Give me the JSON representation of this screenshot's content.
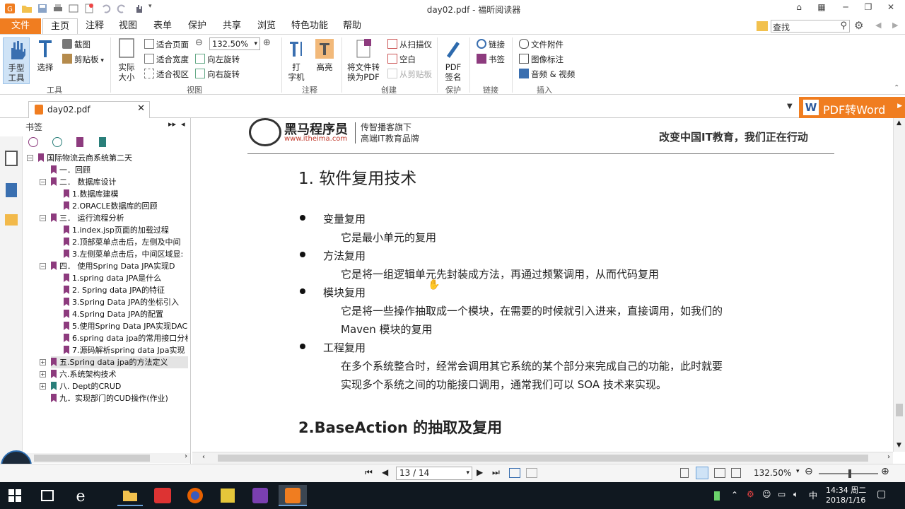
{
  "window": {
    "title": "day02.pdf - 福昕阅读器"
  },
  "menu": {
    "file": "文件",
    "tabs": [
      "主页",
      "注释",
      "视图",
      "表单",
      "保护",
      "共享",
      "浏览",
      "特色功能",
      "帮助"
    ],
    "search_placeholder": "查找"
  },
  "ribbon": {
    "tools": {
      "hand": "手型\n工具",
      "hand_l1": "手型",
      "hand_l2": "工具",
      "select": "选择",
      "screenshot": "截图",
      "clipboard": "剪贴板",
      "group": "工具"
    },
    "view": {
      "actual_l1": "实际",
      "actual_l2": "大小",
      "fit_page": "适合页面",
      "fit_width": "适合宽度",
      "fit_visible": "适合视区",
      "zoom_value": "132.50%",
      "rotate_left": "向左旋转",
      "rotate_right": "向右旋转",
      "group": "视图"
    },
    "comment": {
      "type_l1": "打",
      "type_l2": "字机",
      "highlight": "高亮",
      "group": "注释"
    },
    "create": {
      "convert_l1": "将文件转",
      "convert_l2": "换为PDF",
      "from_scanner": "从扫描仪",
      "blank": "空白",
      "from_clipboard": "从剪贴板",
      "group": "创建"
    },
    "protect": {
      "sign_l1": "PDF",
      "sign_l2": "签名",
      "group": "保护"
    },
    "links": {
      "link": "链接",
      "bookmark": "书签",
      "group": "链接"
    },
    "insert": {
      "attachment": "文件附件",
      "image_annot": "图像标注",
      "audio_video": "音频 & 视频",
      "group": "插入"
    }
  },
  "doc_tab": {
    "name": "day02.pdf"
  },
  "pdf2word": "PDF转Word",
  "bookmarks": {
    "title": "书签",
    "items": [
      "国际物流云商系统第二天",
      "一．回顾",
      "二．  数据库设计",
      "1.数据库建模",
      "2.ORACLE数据库的回顾",
      "三．  运行流程分析",
      "1.index.jsp页面的加载过程",
      "2.顶部菜单点击后，左侧及中间",
      "3.左侧菜单点击后，中间区域显:",
      "四．  使用Spring   Data   JPA实现D",
      "1.spring data JPA是什么",
      "2. Spring data JPA的特征",
      "3.Spring Data JPA的坐标引入",
      "4.Spring Data JPA的配置",
      "5.使用Spring Data JPA实现DAC",
      "6.spring data jpa的常用接口分析",
      "7.源码解析spring data Jpa实现",
      "五.Spring data jpa的方法定义",
      "六.系统架构技术",
      "八. Dept的CRUD",
      "九．实现部门的CUD操作(作业)"
    ]
  },
  "document": {
    "logo_name": "黑马程序员",
    "logo_url": "www.itheima.com",
    "logo_tag1": "传智播客旗下",
    "logo_tag2": "高端IT教育品牌",
    "slogan": "改变中国IT教育，我们正在行动",
    "heading1": "1.  软件复用技术",
    "b1_title": "变量复用",
    "b1_text": "它是最小单元的复用",
    "b2_title": "方法复用",
    "b2_text": "它是将一组逻辑单元先封装成方法，再通过频繁调用，从而代码复用",
    "b3_title": "模块复用",
    "b3_text1": "它是将一些操作抽取成一个模块，在需要的时候就引入进来，直接调用，如我们的",
    "b3_text2": "Maven 模块的复用",
    "b4_title": "工程复用",
    "b4_text1": "在多个系统整合时，经常会调用其它系统的某个部分来完成自己的功能，此时就要",
    "b4_text2": "实现多个系统之间的功能接口调用，通常我们可以 SOA 技术来实现。",
    "heading2": "2.BaseAction 的抽取及复用"
  },
  "status": {
    "page": "13 / 14",
    "zoom": "132.50%"
  },
  "taskbar": {
    "time": "14:34 周二",
    "date": "2018/1/16",
    "ime": "中"
  },
  "colors": {
    "accent": "#f07d20",
    "bookmark": "#8d3b7e",
    "taskbar": "#101820"
  }
}
